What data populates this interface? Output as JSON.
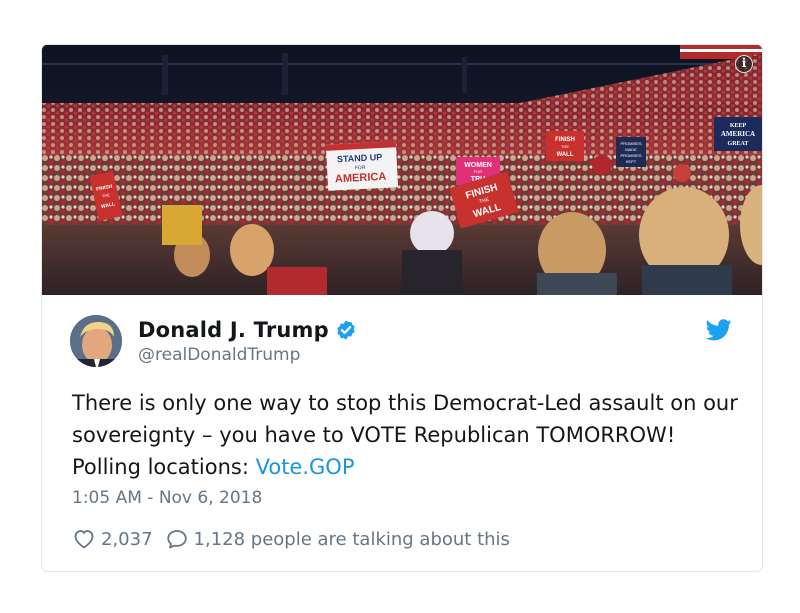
{
  "photo": {
    "signs": {
      "stand_up": [
        "STAND UP",
        "FOR",
        "AMERICA"
      ],
      "finish_wall_small": [
        "FINISH",
        "THE",
        "WALL"
      ],
      "keep_america": [
        "KEEP",
        "AMERICA",
        "GREAT"
      ],
      "women_for": [
        "WOMEN",
        "FOR",
        "TRU"
      ],
      "finish_wall_big": [
        "FINISH",
        "THE",
        "WALL"
      ],
      "promises": [
        "PROMISES",
        "MADE",
        "PROMISES",
        "KEPT"
      ],
      "finish_left": [
        "FINISH",
        "THE",
        "WALL"
      ]
    },
    "info_glyph": "i"
  },
  "tweet": {
    "display_name": "Donald J. Trump",
    "handle": "@realDonaldTrump",
    "text_before_link": "There is only one way to stop this Democrat-Led assault on our sovereignty – you have to VOTE Republican TOMORROW! Polling locations: ",
    "link_text": "Vote.GOP",
    "timestamp": "1:05 AM - Nov 6, 2018",
    "likes": "2,037",
    "replies_text": "1,128 people are talking about this"
  },
  "colors": {
    "verified": "#1da1f2",
    "twitter_blue": "#1da1f2",
    "link": "#1b95e0",
    "muted": "#657786",
    "text": "#14171a"
  },
  "icons": {
    "verified": "verified-badge-icon",
    "bird": "twitter-bird-icon",
    "like": "heart-icon",
    "reply": "speech-bubble-icon",
    "info": "info-icon"
  }
}
